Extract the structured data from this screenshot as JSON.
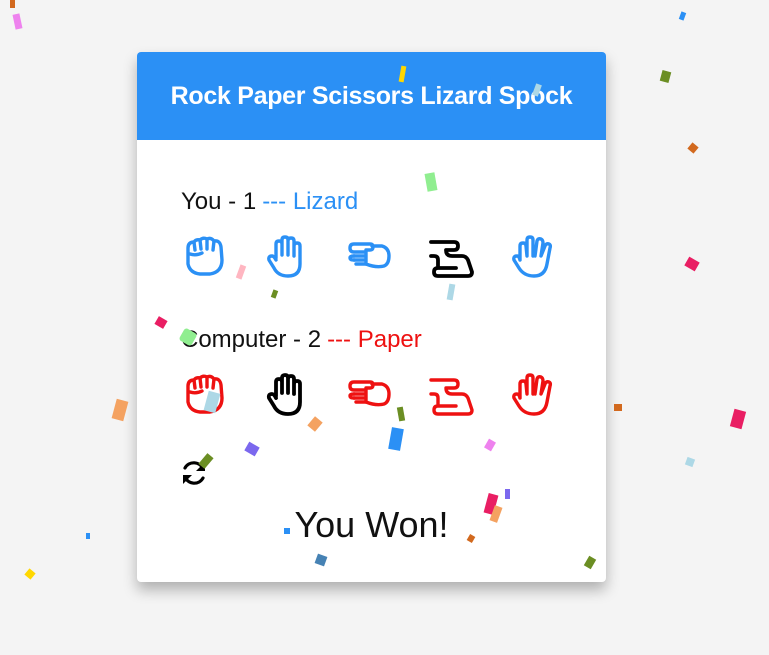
{
  "header": {
    "title": "Rock Paper Scissors Lizard Spock"
  },
  "player": {
    "label": "You - 1",
    "choice": "--- Lizard",
    "hands": [
      {
        "name": "rock-icon",
        "color": "#2b90f5"
      },
      {
        "name": "paper-icon",
        "color": "#2b90f5"
      },
      {
        "name": "scissors-icon",
        "color": "#2b90f5"
      },
      {
        "name": "lizard-icon",
        "color": "#000000",
        "selected": true
      },
      {
        "name": "spock-icon",
        "color": "#2b90f5"
      }
    ]
  },
  "computer": {
    "label": "Computer - 2",
    "choice": "--- Paper",
    "hands": [
      {
        "name": "rock-icon",
        "color": "#ee1111"
      },
      {
        "name": "paper-icon",
        "color": "#000000",
        "selected": true
      },
      {
        "name": "scissors-icon",
        "color": "#ee1111"
      },
      {
        "name": "lizard-icon",
        "color": "#ee1111"
      },
      {
        "name": "spock-icon",
        "color": "#ee1111"
      }
    ]
  },
  "controls": {
    "restart_icon": "refresh-icon"
  },
  "result": {
    "text": "You Won!"
  },
  "colors": {
    "accent": "#2b90f5",
    "computer": "#ee1111",
    "selected": "#000000",
    "confetti": [
      "#e91e63",
      "#2b90f5",
      "#6b8e23",
      "#ff9800",
      "#90ee90",
      "#add8e6",
      "#7b68ee",
      "#ffd700",
      "#ee82ee",
      "#d2691e"
    ]
  }
}
